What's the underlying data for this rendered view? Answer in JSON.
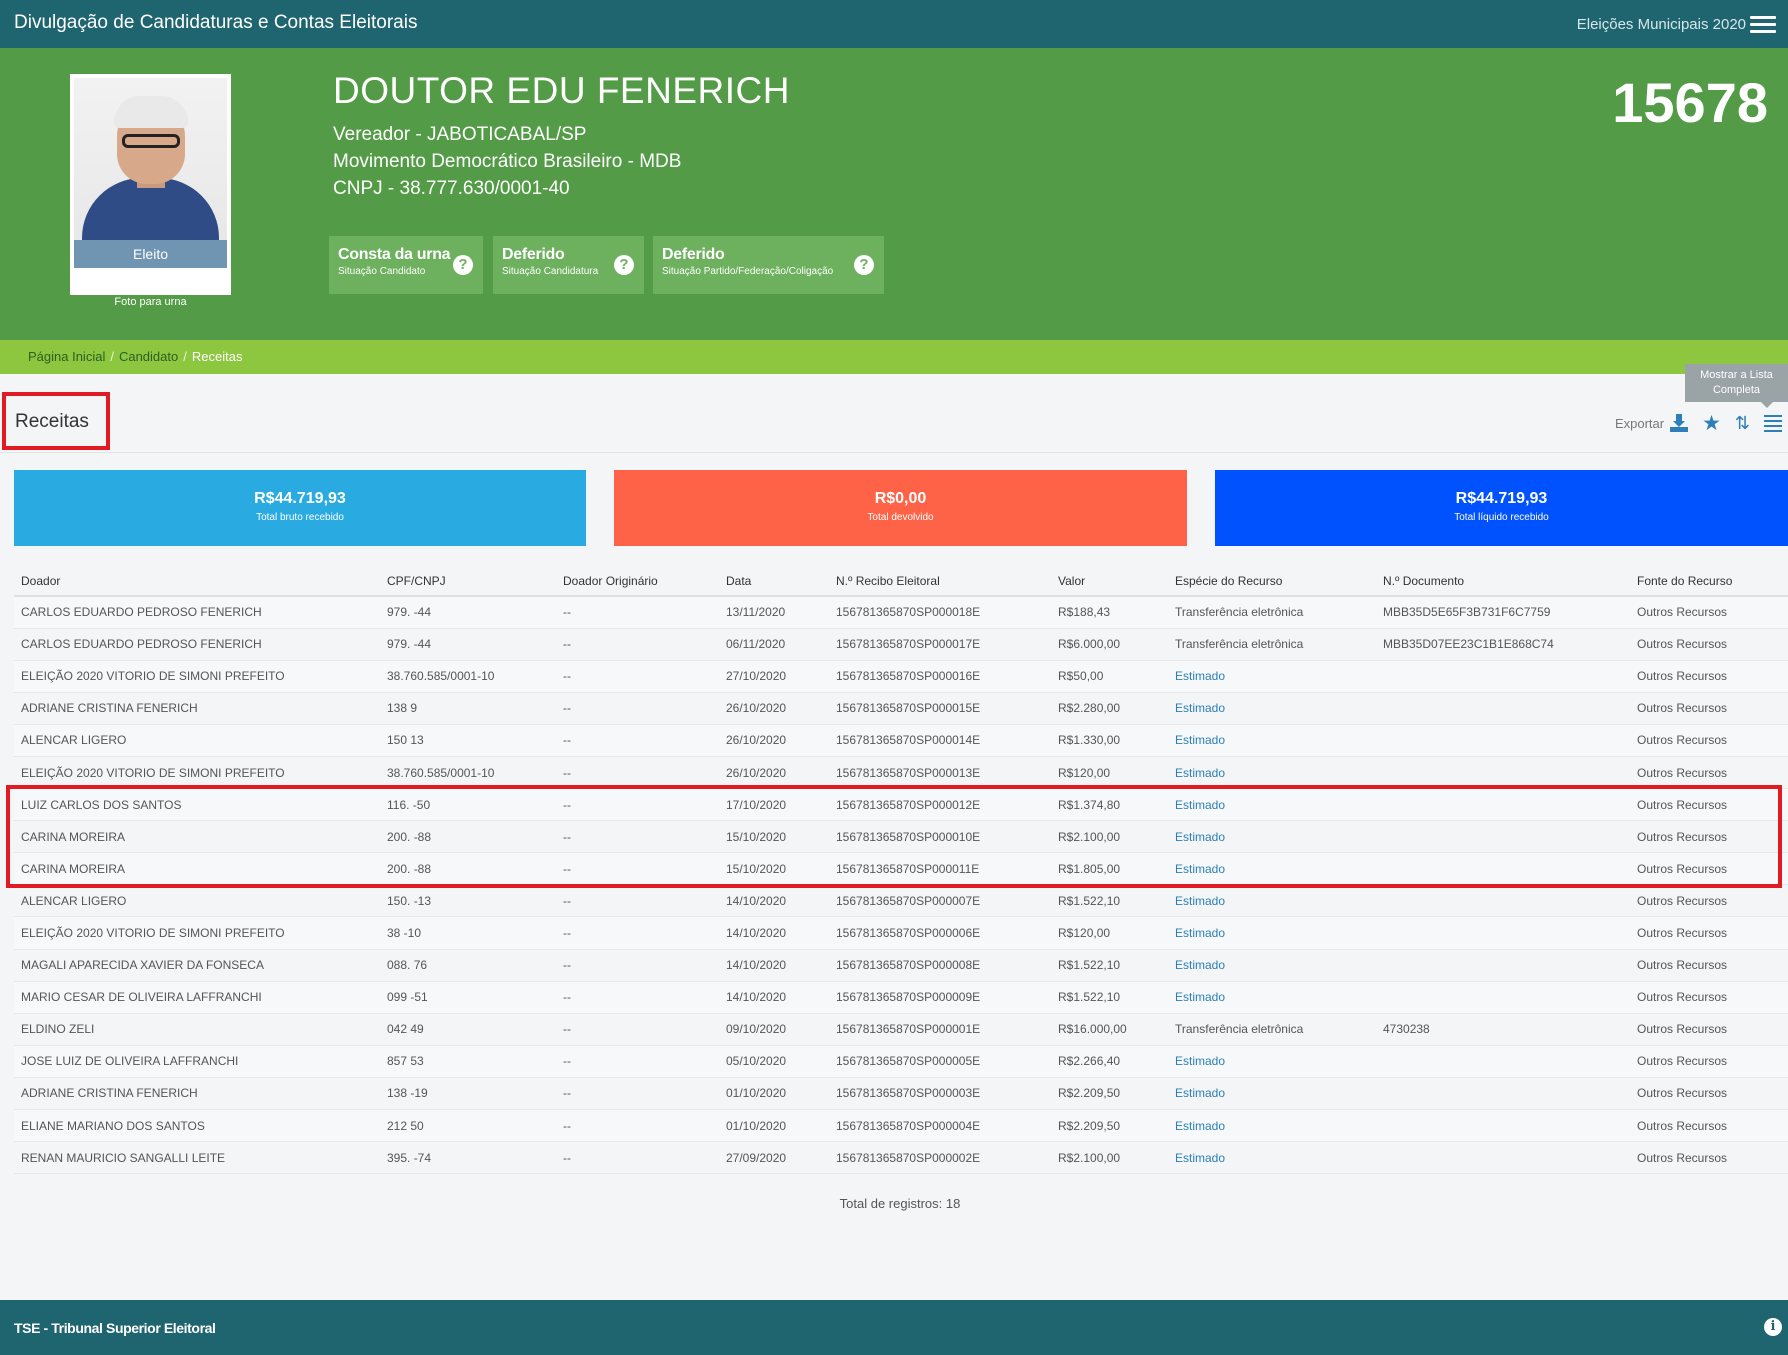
{
  "topbar": {
    "app_title": "Divulgação de Candidaturas e Contas Eleitorais",
    "election": "Eleições Municipais 2020"
  },
  "candidate": {
    "name": "DOUTOR EDU FENERICH",
    "office": "Vereador - JABOTICABAL/SP",
    "party": "Movimento Democrático Brasileiro - MDB",
    "cnpj": "CNPJ - 38.777.630/0001-40",
    "number": "15678",
    "photo_status": "Eleito",
    "photo_caption": "Foto para urna"
  },
  "badges": [
    {
      "title": "Consta da urna",
      "subtitle": "Situação Candidato"
    },
    {
      "title": "Deferido",
      "subtitle": "Situação Candidatura"
    },
    {
      "title": "Deferido",
      "subtitle": "Situação Partido/Federação/Coligação"
    }
  ],
  "breadcrumb": [
    "Página Inicial",
    "Candidato",
    "Receitas"
  ],
  "section": {
    "title": "Receitas",
    "export_label": "Exportar",
    "tooltip": "Mostrar a Lista Completa"
  },
  "summary": [
    {
      "value": "R$44.719,93",
      "label": "Total bruto recebido",
      "color": "#29abe2"
    },
    {
      "value": "R$0,00",
      "label": "Total devolvido",
      "color": "#ff6347"
    },
    {
      "value": "R$44.719,93",
      "label": "Total líquido recebido",
      "color": "#0052ff"
    }
  ],
  "table": {
    "columns": [
      "Doador",
      "CPF/CNPJ",
      "Doador Originário",
      "Data",
      "N.º Recibo Eleitoral",
      "Valor",
      "Espécie do Recurso",
      "N.º Documento",
      "Fonte do Recurso"
    ],
    "rows": [
      [
        "CARLOS EDUARDO PEDROSO FENERICH",
        "979.            -44",
        "--",
        "13/11/2020",
        "156781365870SP000018E",
        "R$188,43",
        "Transferência eletrônica",
        "MBB35D5E65F3B731F6C7759",
        "Outros Recursos"
      ],
      [
        "CARLOS EDUARDO PEDROSO FENERICH",
        "979.            -44",
        "--",
        "06/11/2020",
        "156781365870SP000017E",
        "R$6.000,00",
        "Transferência eletrônica",
        "MBB35D07EE23C1B1E868C74",
        "Outros Recursos"
      ],
      [
        "ELEIÇÃO 2020 VITORIO DE SIMONI PREFEITO",
        "38.760.585/0001-10",
        "--",
        "27/10/2020",
        "156781365870SP000016E",
        "R$50,00",
        "Estimado",
        "",
        "Outros Recursos"
      ],
      [
        "ADRIANE CRISTINA FENERICH",
        "138            9",
        "--",
        "26/10/2020",
        "156781365870SP000015E",
        "R$2.280,00",
        "Estimado",
        "",
        "Outros Recursos"
      ],
      [
        "ALENCAR LIGERO",
        "150            13",
        "--",
        "26/10/2020",
        "156781365870SP000014E",
        "R$1.330,00",
        "Estimado",
        "",
        "Outros Recursos"
      ],
      [
        "ELEIÇÃO 2020 VITORIO DE SIMONI PREFEITO",
        "38.760.585/0001-10",
        "--",
        "26/10/2020",
        "156781365870SP000013E",
        "R$120,00",
        "Estimado",
        "",
        "Outros Recursos"
      ],
      [
        "LUIZ CARLOS DOS SANTOS",
        "116.            -50",
        "--",
        "17/10/2020",
        "156781365870SP000012E",
        "R$1.374,80",
        "Estimado",
        "",
        "Outros Recursos"
      ],
      [
        "CARINA MOREIRA",
        "200.            -88",
        "--",
        "15/10/2020",
        "156781365870SP000010E",
        "R$2.100,00",
        "Estimado",
        "",
        "Outros Recursos"
      ],
      [
        "CARINA MOREIRA",
        "200.            -88",
        "--",
        "15/10/2020",
        "156781365870SP000011E",
        "R$1.805,00",
        "Estimado",
        "",
        "Outros Recursos"
      ],
      [
        "ALENCAR LIGERO",
        "150.            -13",
        "--",
        "14/10/2020",
        "156781365870SP000007E",
        "R$1.522,10",
        "Estimado",
        "",
        "Outros Recursos"
      ],
      [
        "ELEIÇÃO 2020 VITORIO DE SIMONI PREFEITO",
        "38            -10",
        "--",
        "14/10/2020",
        "156781365870SP000006E",
        "R$120,00",
        "Estimado",
        "",
        "Outros Recursos"
      ],
      [
        "MAGALI APARECIDA XAVIER DA FONSECA",
        "088.            76",
        "--",
        "14/10/2020",
        "156781365870SP000008E",
        "R$1.522,10",
        "Estimado",
        "",
        "Outros Recursos"
      ],
      [
        "MARIO CESAR DE OLIVEIRA LAFFRANCHI",
        "099            -51",
        "--",
        "14/10/2020",
        "156781365870SP000009E",
        "R$1.522,10",
        "Estimado",
        "",
        "Outros Recursos"
      ],
      [
        "ELDINO ZELI",
        "042            49",
        "--",
        "09/10/2020",
        "156781365870SP000001E",
        "R$16.000,00",
        "Transferência eletrônica",
        "4730238",
        "Outros Recursos"
      ],
      [
        "JOSE LUIZ DE OLIVEIRA LAFFRANCHI",
        "857            53",
        "--",
        "05/10/2020",
        "156781365870SP000005E",
        "R$2.266,40",
        "Estimado",
        "",
        "Outros Recursos"
      ],
      [
        "ADRIANE CRISTINA FENERICH",
        "138            -19",
        "--",
        "01/10/2020",
        "156781365870SP000003E",
        "R$2.209,50",
        "Estimado",
        "",
        "Outros Recursos"
      ],
      [
        "ELIANE MARIANO DOS SANTOS",
        "212            50",
        "--",
        "01/10/2020",
        "156781365870SP000004E",
        "R$2.209,50",
        "Estimado",
        "",
        "Outros Recursos"
      ],
      [
        "RENAN MAURICIO SANGALLI LEITE",
        "395.            -74",
        "--",
        "27/09/2020",
        "156781365870SP000002E",
        "R$2.100,00",
        "Estimado",
        "",
        "Outros Recursos"
      ]
    ],
    "total": "Total de registros: 18"
  },
  "footer": {
    "title": "TSE - Tribunal Superior Eleitoral"
  }
}
